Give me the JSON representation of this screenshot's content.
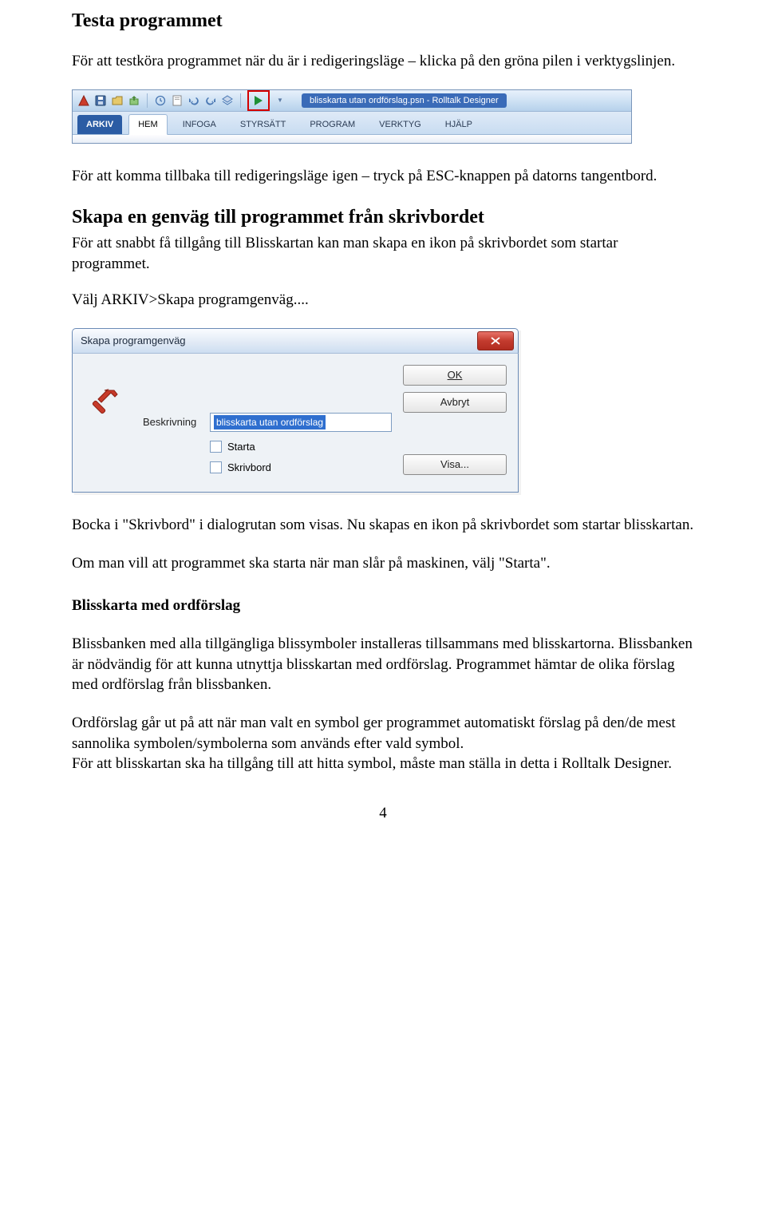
{
  "title": "Testa programmet",
  "p1": "För att testköra programmet när du är i redigeringsläge – klicka på den gröna pilen i verktygslinjen.",
  "ribbon": {
    "file_chip": "blisskarta utan ordförslag.psn - Rolltalk Designer",
    "tabs": {
      "arkiv": "ARKIV",
      "hem": "HEM",
      "infoga": "INFOGA",
      "styrsatt": "STYRSÄTT",
      "program": "PROGRAM",
      "verktyg": "VERKTYG",
      "hjalp": "HJÄLP"
    }
  },
  "p2": "För att komma tillbaka till redigeringsläge igen – tryck på ESC-knappen på datorns tangentbord.",
  "h2": "Skapa en genväg till programmet från skrivbordet",
  "p3": "För att snabbt få tillgång till Blisskartan kan man skapa en ikon på skrivbordet som startar programmet.",
  "p4": "Välj ARKIV>Skapa programgenväg....",
  "dialog": {
    "title": "Skapa programgenväg",
    "ok": "OK",
    "avbryt": "Avbryt",
    "visa": "Visa...",
    "desc_label": "Beskrivning",
    "desc_value": "blisskarta utan ordförslag",
    "starta": "Starta",
    "skrivbord": "Skrivbord"
  },
  "p5": "Bocka i \"Skrivbord\" i dialogrutan som visas. Nu skapas en ikon på skrivbordet som startar blisskartan.",
  "p6": "Om man vill att programmet ska starta när man slår på maskinen, välj \"Starta\".",
  "h3": "Blisskarta med ordförslag",
  "p7": "Blissbanken med alla tillgängliga blissymboler installeras tillsammans med blisskartorna. Blissbanken är nödvändig för att kunna utnyttja blisskartan med ordförslag. Programmet hämtar de olika förslag med ordförslag från blissbanken.",
  "p8a": "Ordförslag går ut på att när man valt en symbol ger programmet automatiskt förslag på den/de mest sannolika symbolen/symbolerna som används efter vald symbol.",
  "p8b": "För att blisskartan ska ha tillgång till att hitta symbol, måste man ställa in detta i Rolltalk Designer.",
  "page_num": "4"
}
